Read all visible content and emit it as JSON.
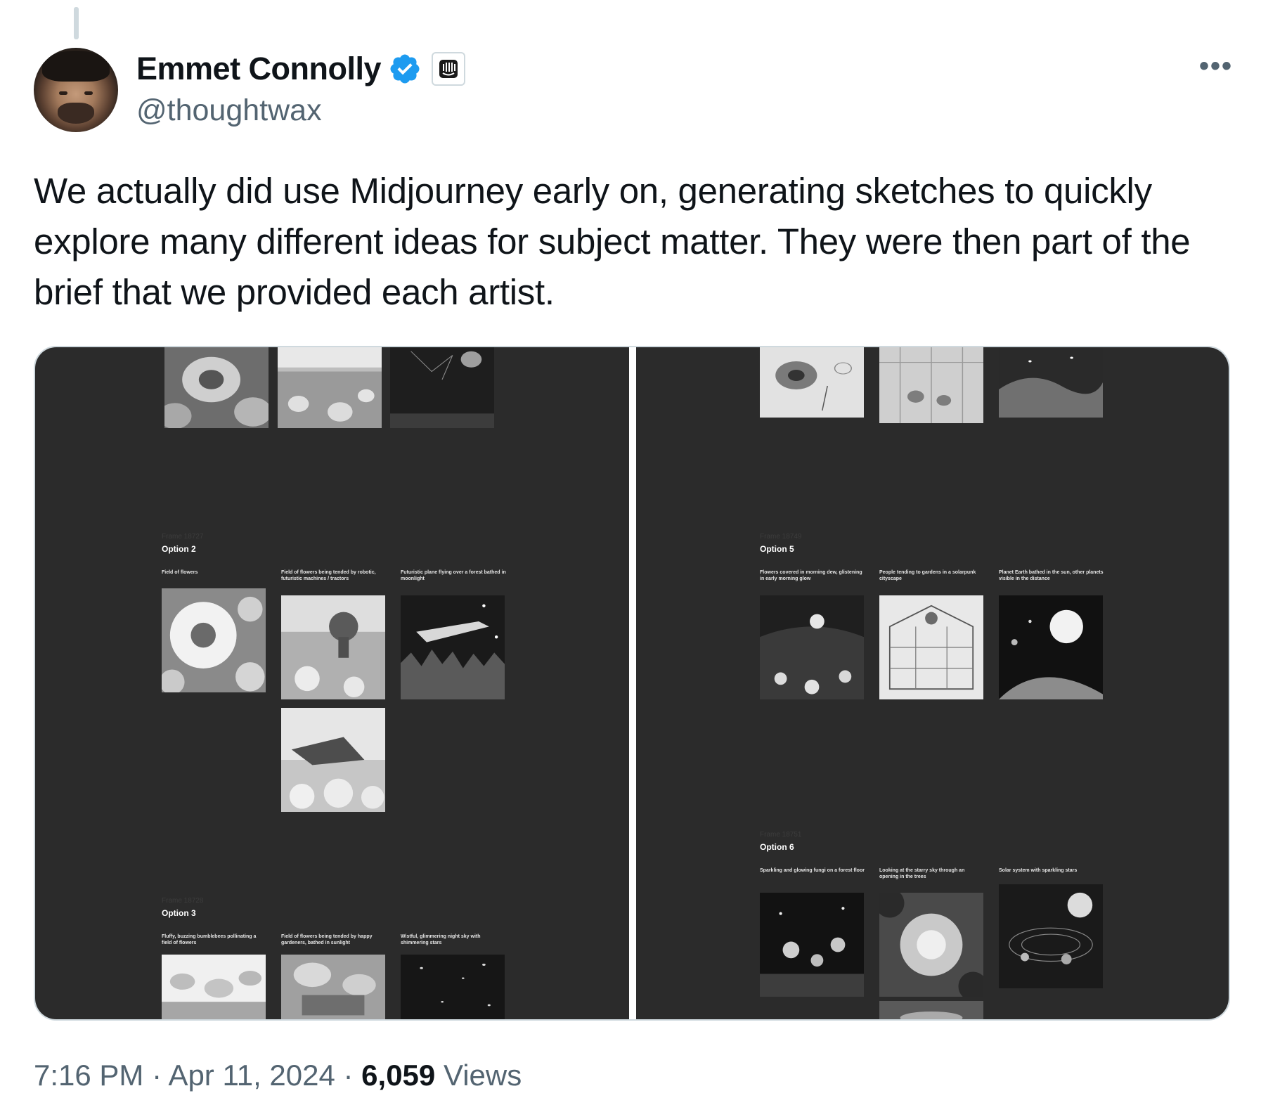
{
  "author": {
    "name": "Emmet Connolly",
    "handle": "@thoughtwax",
    "verified_color": "#1d9bf0",
    "org_badge_icon": "intercom-icon"
  },
  "tweet": {
    "text": "We actually did use Midjourney early on, generating sketches to quickly explore many different ideas for subject matter. They were then part of the brief that we provided each artist."
  },
  "media": {
    "background_color": "#2b2b2b",
    "left": {
      "option_2": {
        "ghost": "Frame 18727",
        "title": "Option 2",
        "captions": [
          "Field of flowers",
          "Field of flowers being tended by robotic, futuristic machines / tractors",
          "Futuristic plane flying over a forest bathed in moonlight"
        ]
      },
      "option_3": {
        "ghost": "Frame 18728",
        "title": "Option 3",
        "captions": [
          "Fluffy, buzzing bumblebees pollinating a field of flowers",
          "Field of flowers being tended by happy gardeners, bathed in sunlight",
          "Wistful, glimmering night sky with shimmering stars"
        ]
      }
    },
    "right": {
      "option_5": {
        "ghost": "Frame 18749",
        "title": "Option 5",
        "captions": [
          "Flowers covered in morning dew, glistening in early morning glow",
          "People tending to gardens in a solarpunk cityscape",
          "Planet Earth bathed in the sun, other planets visible in the distance"
        ]
      },
      "option_6": {
        "ghost": "Frame 18751",
        "title": "Option 6",
        "captions": [
          "Sparkling and glowing fungi on a forest floor",
          "Looking at the starry sky through an opening in the trees",
          "Solar system with sparkling stars"
        ]
      }
    }
  },
  "meta": {
    "time": "7:16 PM",
    "sep1": " · ",
    "date": "Apr 11, 2024",
    "sep2": " · ",
    "views_count": "6,059",
    "views_label": " Views"
  }
}
